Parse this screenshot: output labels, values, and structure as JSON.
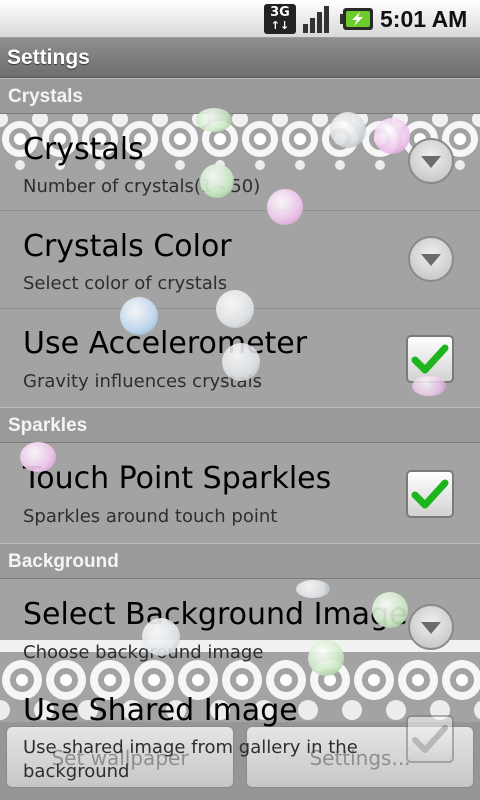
{
  "status_bar": {
    "network_type": "3G",
    "network_icon": "3g-data-icon",
    "signal_icon": "signal-strength-icon",
    "battery_icon": "battery-charging-icon",
    "time": "5:01 AM"
  },
  "title_bar": {
    "title": "Settings"
  },
  "sections": {
    "crystals": {
      "header": "Crystals",
      "count": {
        "title": "Crystals",
        "summary": "Number of crystals(1 - 50)"
      },
      "color": {
        "title": "Crystals Color",
        "summary": "Select color of crystals"
      },
      "accelerometer": {
        "title": "Use Accelerometer",
        "summary": "Gravity influences crystals",
        "checked": true
      }
    },
    "sparkles": {
      "header": "Sparkles",
      "touch": {
        "title": "Touch Point Sparkles",
        "summary": "Sparkles around touch point",
        "checked": true
      }
    },
    "background": {
      "header": "Background",
      "image": {
        "title": "Select Background Image",
        "summary": "Choose background image"
      },
      "shared": {
        "title": "Use Shared Image",
        "summary_line1": "Use shared image from gallery in the",
        "summary_line2": "background",
        "checked": false
      }
    }
  },
  "bottom_bar": {
    "set_wallpaper": "Set wallpaper",
    "settings": "Settings..."
  },
  "colors": {
    "check_green": "#1db41d",
    "status_bar_bg": "#e6e6e6",
    "title_bar_bg": "#7f7f7f",
    "list_bg": "#a3a3a3"
  }
}
